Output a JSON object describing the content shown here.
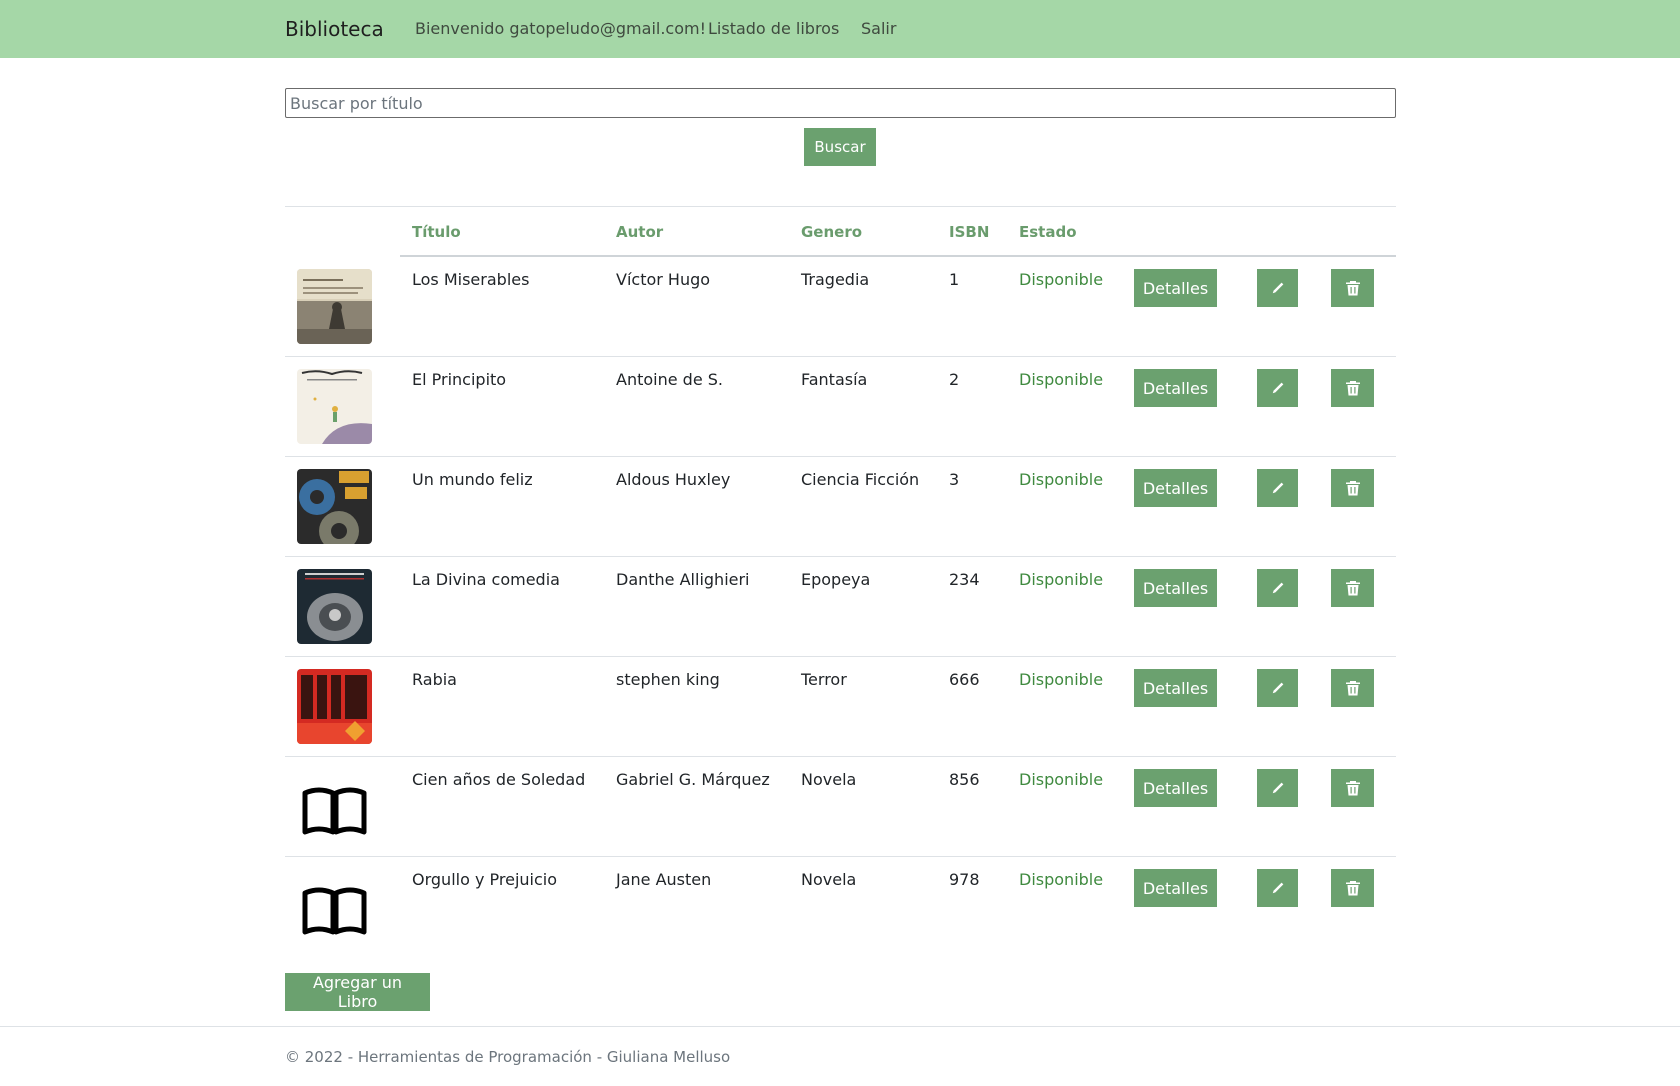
{
  "navbar": {
    "brand": "Biblioteca",
    "welcome": "Bienvenido gatopeludo@gmail.com!",
    "books_link": "Listado de libros",
    "logout_link": "Salir"
  },
  "search": {
    "placeholder": "Buscar por título",
    "value": "",
    "button_label": "Buscar"
  },
  "table": {
    "headers": [
      "Título",
      "Autor",
      "Genero",
      "ISBN",
      "Estado"
    ],
    "rows": [
      {
        "title": "Los Miserables",
        "author": "Víctor Hugo",
        "genre": "Tragedia",
        "isbn": "1",
        "status": "Disponible",
        "cover": "los-miserables-cover"
      },
      {
        "title": "El Principito",
        "author": "Antoine de S.",
        "genre": "Fantasía",
        "isbn": "2",
        "status": "Disponible",
        "cover": "el-principito-cover"
      },
      {
        "title": "Un mundo feliz",
        "author": "Aldous Huxley",
        "genre": "Ciencia Ficción",
        "isbn": "3",
        "status": "Disponible",
        "cover": "un-mundo-feliz-cover"
      },
      {
        "title": "La Divina comedia",
        "author": "Danthe Allighieri",
        "genre": "Epopeya",
        "isbn": "234",
        "status": "Disponible",
        "cover": "divina-comedia-cover"
      },
      {
        "title": "Rabia",
        "author": "stephen king",
        "genre": "Terror",
        "isbn": "666",
        "status": "Disponible",
        "cover": "rabia-cover"
      },
      {
        "title": "Cien años de Soledad",
        "author": "Gabriel G. Márquez",
        "genre": "Novela",
        "isbn": "856",
        "status": "Disponible",
        "cover": "book-open-icon"
      },
      {
        "title": "Orgullo y Prejuicio",
        "author": "Jane Austen",
        "genre": "Novela",
        "isbn": "978",
        "status": "Disponible",
        "cover": "book-open-icon"
      }
    ],
    "details_label": "Detalles",
    "edit_icon": "pencil-icon",
    "delete_icon": "trash-icon"
  },
  "add_button_label": "Agregar un Libro",
  "footer": "© 2022 - Herramientas de Programación - Giuliana Melluso",
  "colors": {
    "navbar": "#a5d7a7",
    "button": "#6ba16f",
    "header_text": "#6a9c6d",
    "status_text": "#3f8a3f"
  }
}
